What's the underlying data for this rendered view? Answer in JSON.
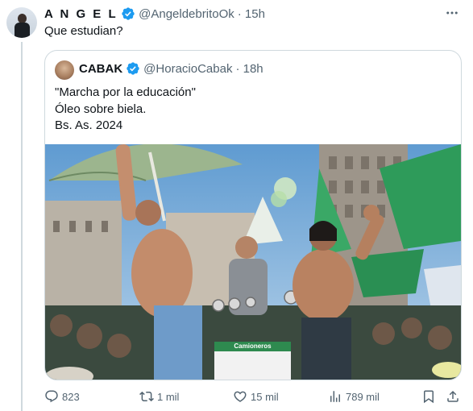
{
  "tweet": {
    "author_name": "A N G E L",
    "handle": "@AngeldebritoOk",
    "time": "· 15h",
    "text": "Que estudian?",
    "more_icon": "more-horizontal-icon"
  },
  "quote": {
    "author_name": "CABAK",
    "handle": "@HoracioCabak",
    "time": "· 18h",
    "lines": [
      "\"Marcha por la educación\"",
      "Óleo sobre biela.",
      "Bs. As. 2024"
    ],
    "photo_caption": "Camioneros"
  },
  "actions": {
    "replies": "823",
    "reposts": "1 mil",
    "likes": "15 mil",
    "views": "789 mil"
  },
  "colors": {
    "text": "#0f1419",
    "secondary": "#536471",
    "border": "#cfd9de",
    "verified": "#1d9bf0",
    "flag_green": "#2e9b5a"
  }
}
